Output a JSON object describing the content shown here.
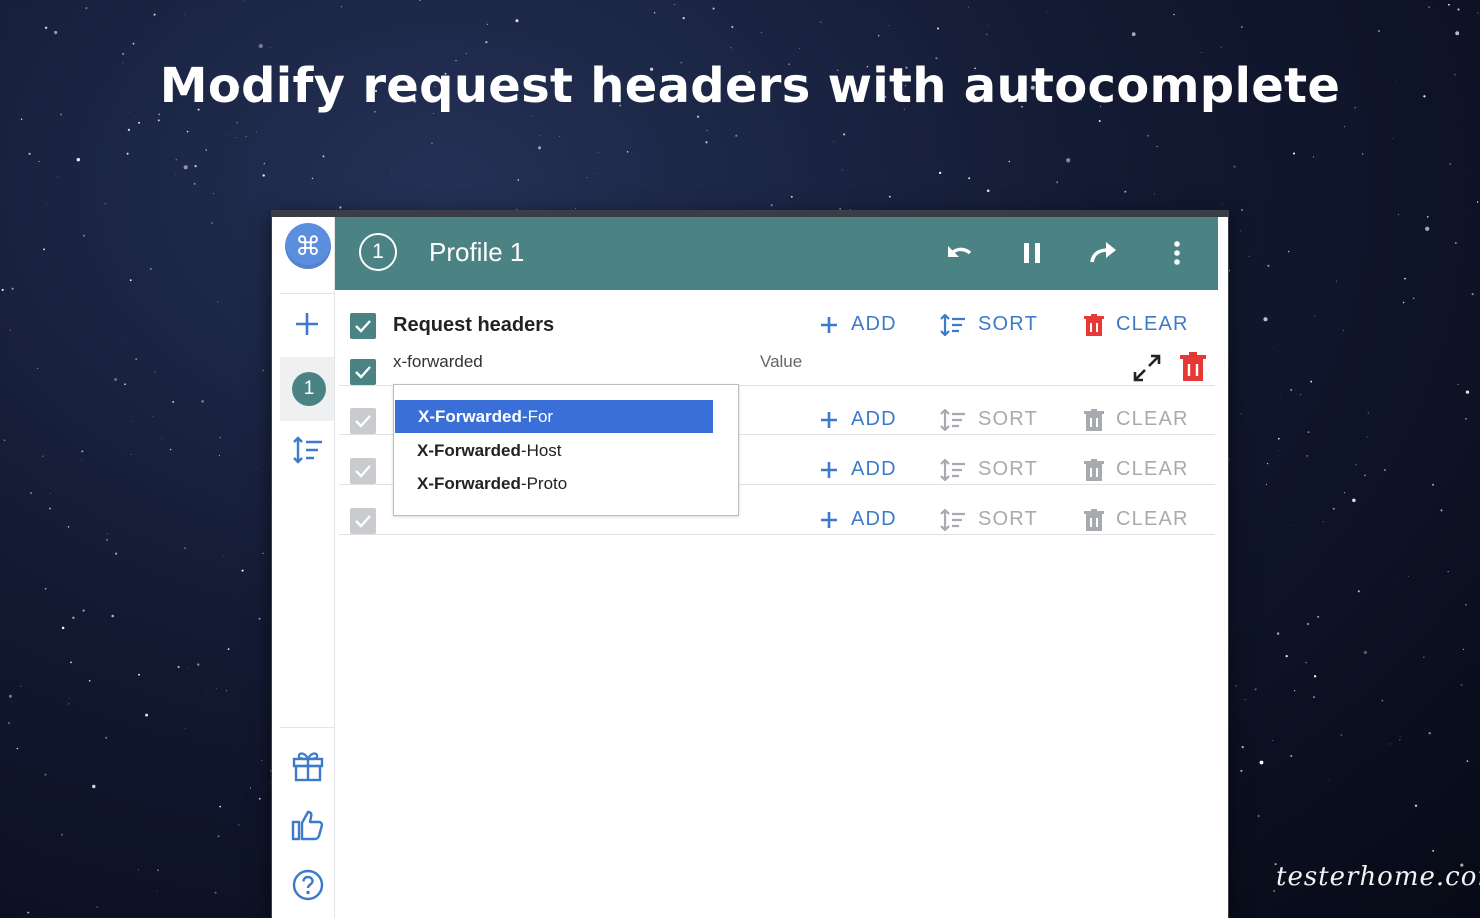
{
  "headline": "Modify request headers with autocomplete",
  "watermark": "testerhome.com",
  "app": {
    "logo_glyph": "⌘",
    "sidebar": {
      "profile_number": "1",
      "icons": [
        "plus-icon",
        "sort-icon",
        "gift-icon",
        "thumbs-up-icon",
        "help-icon"
      ]
    },
    "header": {
      "profile_badge": "1",
      "profile_name": "Profile 1",
      "actions": [
        "undo-icon",
        "pause-icon",
        "redo-icon",
        "more-vert-icon"
      ]
    },
    "request_headers": {
      "title": "Request headers",
      "add_label": "ADD",
      "sort_label": "SORT",
      "clear_label": "CLEAR",
      "entry": {
        "name": "x-forwarded",
        "value_placeholder": "Value"
      },
      "autocomplete": [
        {
          "match": "X-Forwarded",
          "rest": "-For",
          "selected": true
        },
        {
          "match": "X-Forwarded",
          "rest": "-Host",
          "selected": false
        },
        {
          "match": "X-Forwarded",
          "rest": "-Proto",
          "selected": false
        }
      ]
    },
    "disabled_sections": [
      {
        "add_label": "ADD",
        "sort_label": "SORT",
        "clear_label": "CLEAR"
      },
      {
        "add_label": "ADD",
        "sort_label": "SORT",
        "clear_label": "CLEAR"
      },
      {
        "add_label": "ADD",
        "sort_label": "SORT",
        "clear_label": "CLEAR"
      }
    ]
  },
  "colors": {
    "header_bg": "#4b8283",
    "accent_blue": "#3d7ac9",
    "delete_red": "#e53935",
    "selection_blue": "#3b6fd8",
    "disabled_grey": "#a7abaf"
  }
}
